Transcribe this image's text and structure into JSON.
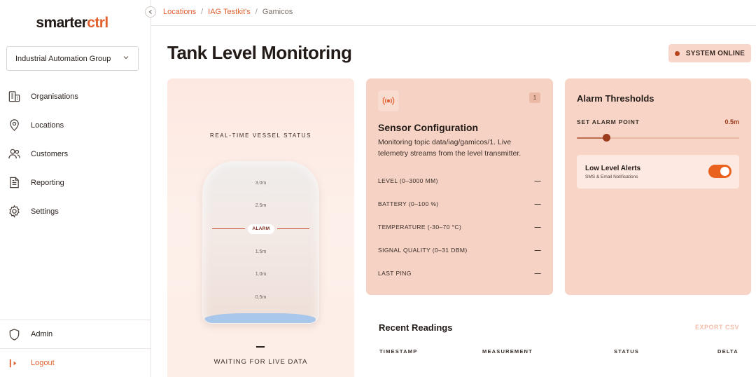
{
  "sidebar": {
    "logo_main": "smarter",
    "logo_accent": "ctrl",
    "org_selector": "Industrial Automation Group",
    "nav": [
      {
        "label": "Organisations",
        "icon": "building-icon"
      },
      {
        "label": "Locations",
        "icon": "map-pin-icon"
      },
      {
        "label": "Customers",
        "icon": "users-icon"
      },
      {
        "label": "Reporting",
        "icon": "document-icon"
      },
      {
        "label": "Settings",
        "icon": "gear-icon"
      }
    ],
    "admin_label": "Admin",
    "logout_label": "Logout"
  },
  "breadcrumb": {
    "items": [
      "Locations",
      "IAG Testkit's"
    ],
    "separator": "/",
    "current": "Gamicos"
  },
  "page": {
    "title": "Tank Level Monitoring",
    "status": "SYSTEM ONLINE"
  },
  "vessel": {
    "label": "REAL-TIME VESSEL STATUS",
    "ticks": [
      "3.0m",
      "2.5m",
      "1.5m",
      "1.0m",
      "0.5m"
    ],
    "alarm_tag": "ALARM",
    "reading": "—",
    "status": "WAITING FOR LIVE DATA"
  },
  "sensor": {
    "badge": "1",
    "title": "Sensor Configuration",
    "description": "Monitoring topic data/iag/gamicos/1. Live telemetry streams from the level transmitter.",
    "metrics": [
      {
        "label": "LEVEL (0–3000 MM)",
        "value": "—"
      },
      {
        "label": "BATTERY (0–100 %)",
        "value": "—"
      },
      {
        "label": "TEMPERATURE (-30–70 °C)",
        "value": "—"
      },
      {
        "label": "SIGNAL QUALITY (0–31 DBM)",
        "value": "—"
      },
      {
        "label": "LAST PING",
        "value": "—"
      }
    ]
  },
  "alarm": {
    "title": "Alarm Thresholds",
    "set_label": "SET ALARM POINT",
    "set_value": "0.5m",
    "slider_fraction": 0.18,
    "alert_title": "Low Level Alerts",
    "alert_sub": "SMS & Email Notifications",
    "alerts_enabled": true
  },
  "readings": {
    "title": "Recent Readings",
    "export_label": "EXPORT CSV",
    "columns": [
      "TIMESTAMP",
      "MEASUREMENT",
      "STATUS",
      "DELTA"
    ]
  },
  "colors": {
    "accent": "#e0602f",
    "panel": "#f5d2c4",
    "toggle_on": "#e9611d",
    "water": "#a8c7ea"
  }
}
